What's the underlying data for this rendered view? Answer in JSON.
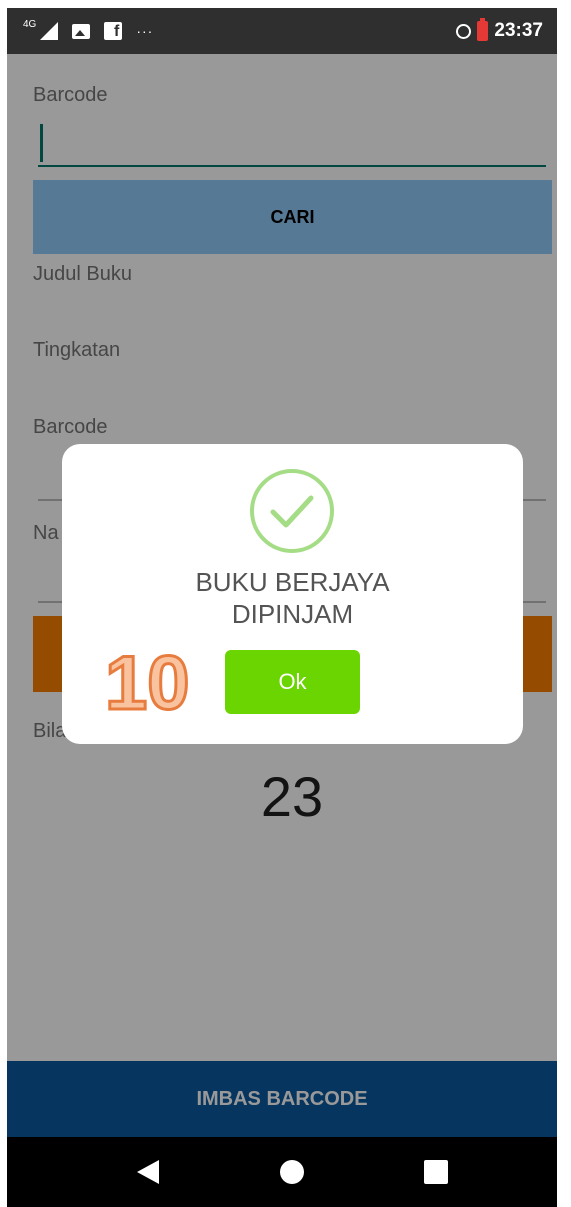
{
  "status_bar": {
    "network": "4G",
    "more": "···",
    "time": "23:37"
  },
  "form": {
    "barcode_label": "Barcode",
    "search_button": "CARI",
    "title_label": "Judul Buku",
    "level_label": "Tingkatan",
    "barcode_label_2": "Barcode",
    "name_label": "Na",
    "count_label": "Bila",
    "count_value": "23"
  },
  "bottom_button": "IMBAS BARCODE",
  "dialog": {
    "message": "BUKU BERJAYA DIPINJAM",
    "ok_button": "Ok"
  },
  "annotation": "10",
  "colors": {
    "status_bar": "#2f2f2f",
    "accent": "#00796b",
    "search_button": "#90caf9",
    "orange_button": "#fb7f00",
    "bottom_button": "#0a5a9e",
    "ok_button": "#6ad500",
    "success_icon": "#a5dc86"
  }
}
